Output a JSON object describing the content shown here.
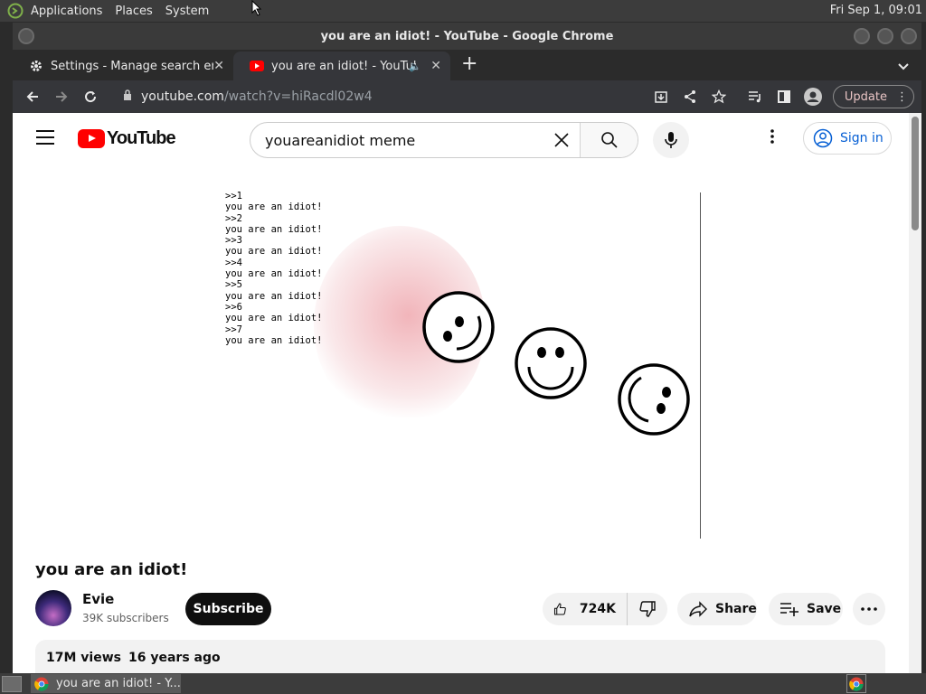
{
  "topbar": {
    "menus": [
      "Applications",
      "Places",
      "System"
    ],
    "clock": "Fri Sep  1, 09:01"
  },
  "window": {
    "title": "you are an idiot! - YouTube - Google Chrome"
  },
  "tabs": [
    {
      "title": "Settings - Manage search engi",
      "icon": "gear-icon",
      "active": false
    },
    {
      "title": "you are an idiot! - YouTube",
      "icon": "youtube-icon",
      "active": true,
      "audio": true
    }
  ],
  "omnibox": {
    "host": "youtube.com",
    "path": "/watch?v=hiRacdl02w4"
  },
  "toolbar": {
    "update_label": "Update"
  },
  "youtube": {
    "logo_text": "YouTube",
    "search_value": "youareanidiot meme",
    "signin_label": "Sign in"
  },
  "video": {
    "terminal_lines": [
      ">>1",
      "you are an idiot!",
      ">>2",
      "you are an idiot!",
      ">>3",
      "you are an idiot!",
      ">>4",
      "you are an idiot!",
      ">>5",
      "you are an idiot!",
      ">>6",
      "you are an idiot!",
      ">>7",
      "you are an idiot!"
    ],
    "title": "you are an idiot!",
    "channel": "Evie",
    "subscribers": "39K subscribers",
    "subscribe_label": "Subscribe",
    "likes": "724K",
    "share_label": "Share",
    "save_label": "Save",
    "views": "17M views",
    "age": "16 years ago"
  },
  "taskbar": {
    "task_title": "you are an idiot! - Y..."
  }
}
